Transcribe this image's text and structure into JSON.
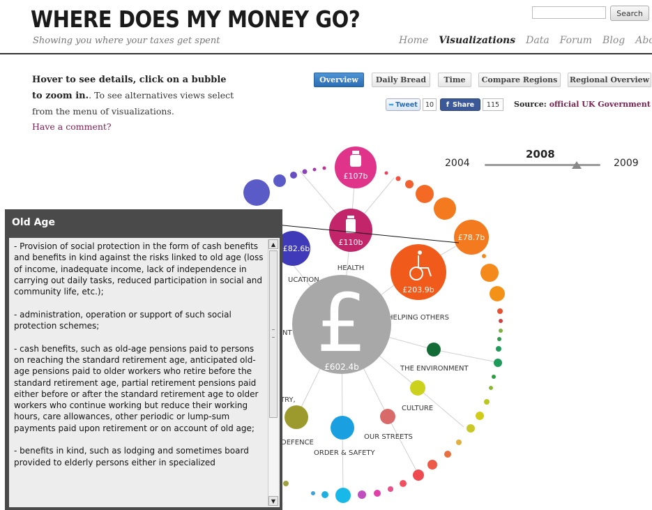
{
  "header": {
    "title": "WHERE DOES MY MONEY GO?",
    "tagline": "Showing you where your taxes get spent",
    "search_button": "Search",
    "search_value": ""
  },
  "nav": {
    "items": [
      {
        "label": "Home",
        "active": false
      },
      {
        "label": "Visualizations",
        "active": true
      },
      {
        "label": "Data",
        "active": false
      },
      {
        "label": "Forum",
        "active": false
      },
      {
        "label": "Blog",
        "active": false
      },
      {
        "label": "About",
        "active": false
      }
    ]
  },
  "intro": {
    "bold_text": "Hover to see details, click on a bubble to zoom in.",
    "rest_text": ". To see alternatives views select from the menu of visualizations.",
    "comment_link": "Have a comment?"
  },
  "tabs": [
    {
      "label": "Overview",
      "active": true
    },
    {
      "label": "Daily Bread",
      "active": false
    },
    {
      "label": "Time",
      "active": false
    },
    {
      "label": "Compare Regions",
      "active": false
    },
    {
      "label": "Regional Overview",
      "active": false
    }
  ],
  "social": {
    "tweet_label": "Tweet",
    "tweet_count": "10",
    "share_label": "Share",
    "share_count": "115"
  },
  "source": {
    "prefix": "Source:",
    "link": "official UK Government data"
  },
  "year_slider": {
    "start": "2004",
    "end": "2009",
    "current": "2008"
  },
  "bubbles": {
    "center_value": "£602.4b",
    "health_value": "£110b",
    "health_label": "HEALTH",
    "top_value": "£107b",
    "helping_others_value": "£203.9b",
    "helping_others_label": "HELPING OTHERS",
    "old_age_value": "£78.7b",
    "education_value": "£82.6b",
    "education_label_partial": "UCATION",
    "environment_label": "THE ENVIRONMENT",
    "culture_label": "CULTURE",
    "streets_label": "OUR STREETS",
    "order_label": "ORDER & SAFETY",
    "defence_label_partial": "DEFENCE",
    "industry_label_partial": "TRY,",
    "partial_label_nt": "NT"
  },
  "tooltip": {
    "title": "Old Age",
    "body": "- Provision of social protection in the form of cash benefits and benefits in kind against the risks linked to old age (loss of income, inadequate income, lack of independence in carrying out daily tasks, reduced participation in social and community life, etc.);\n\n- administration, operation or support of such social protection schemes;\n\n- cash benefits, such as old-age pensions paid to persons on reaching the standard retirement age, anticipated old-age pensions paid to older workers who retire before the standard retirement age, partial retirement pensions paid either before or after the standard retirement age to older workers who continue working but reduce their working hours, care allowances, other periodic or lump-sum payments paid upon retirement or on account of old age;\n\n- benefits in kind, such as lodging and sometimes board provided to elderly persons either in specialized"
  },
  "colors": {
    "pink": "#e0338a",
    "crimson": "#c3256a",
    "orange": "#f05a1a",
    "gray": "#a8a8a8",
    "tooltip_dark": "#4a4a4a",
    "tab_active": "#2a6db3"
  }
}
